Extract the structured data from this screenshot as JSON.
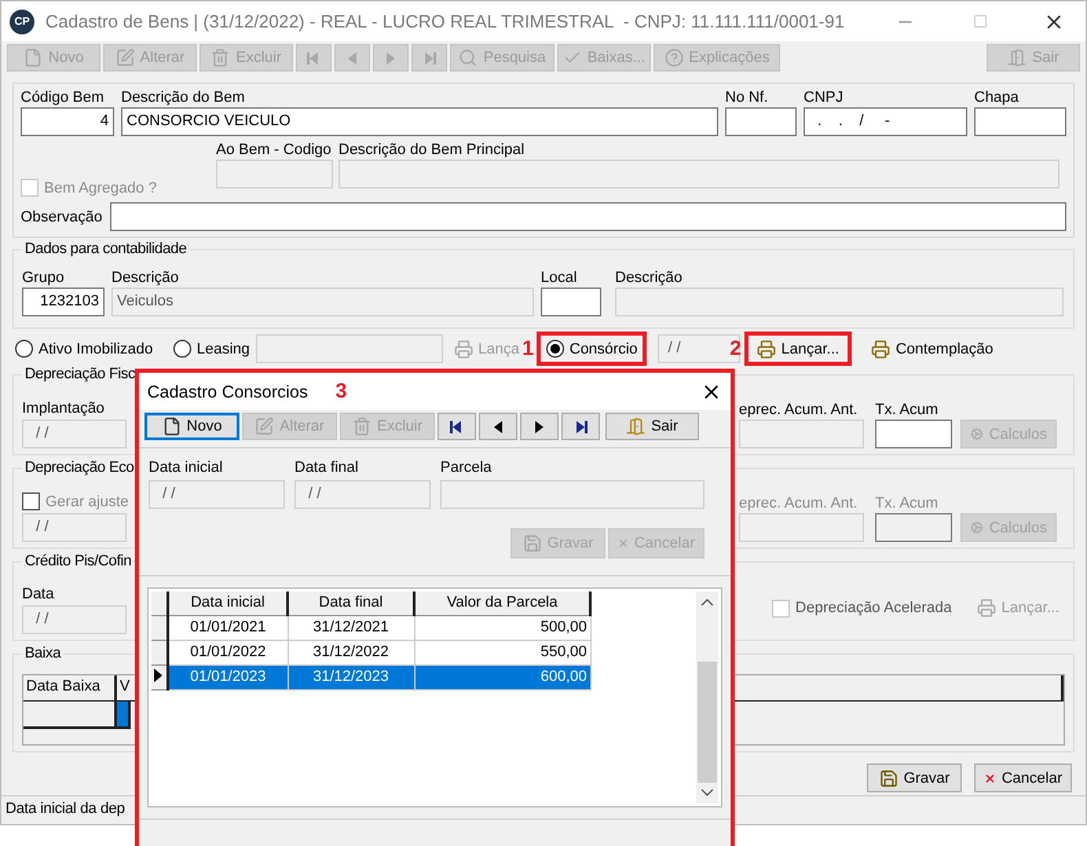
{
  "window": {
    "title": "Cadastro de Bens | (31/12/2022) - REAL - LUCRO REAL TRIMESTRAL  - CNPJ: 11.111.111/0001-91",
    "app_icon": "CP"
  },
  "toolbar": [
    {
      "kind": "new",
      "label": "Novo",
      "disabled": true
    },
    {
      "kind": "edit",
      "label": "Alterar",
      "disabled": true
    },
    {
      "kind": "delete",
      "label": "Excluir",
      "disabled": true
    },
    {
      "kind": "first",
      "disabled": true
    },
    {
      "kind": "prev",
      "disabled": true
    },
    {
      "kind": "next",
      "disabled": true
    },
    {
      "kind": "last",
      "disabled": true
    },
    {
      "kind": "search",
      "label": "Pesquisa",
      "disabled": true
    },
    {
      "kind": "check",
      "label": "Baixas...",
      "disabled": true
    },
    {
      "kind": "help",
      "label": "Explicações",
      "disabled": true
    },
    {
      "kind": "exit",
      "label": "Sair",
      "disabled": true
    }
  ],
  "header_fields": [
    {
      "label": "Código Bem",
      "value": "4"
    },
    {
      "label": "Descrição do Bem",
      "value": "CONSORCIO VEICULO"
    },
    {
      "label": "No Nf."
    },
    {
      "label": "CNPJ",
      "value": "  .    .    /     -"
    },
    {
      "label": "Chapa"
    }
  ],
  "bem_agregado": {
    "label": "Bem Agregado ?",
    "checked": false,
    "disabled": true
  },
  "principal_fields": [
    {
      "label": "Ao Bem - Codigo"
    },
    {
      "label": "Descrição do Bem Principal"
    }
  ],
  "observacao": {
    "label": "Observação"
  },
  "contabilidade": {
    "title": "Dados para contabilidade",
    "fields": [
      {
        "label": "Grupo",
        "value": "1232103",
        "disabled": false
      },
      {
        "label": "Descrição",
        "value": "Veiculos",
        "disabled": true
      },
      {
        "label": "Local",
        "disabled": false
      },
      {
        "label": "Descrição",
        "disabled": true
      }
    ]
  },
  "tipo": {
    "radios": [
      {
        "label": "Ativo Imobilizado",
        "selected": false
      },
      {
        "label": "Leasing",
        "selected": false
      },
      {
        "label": "Consórcio",
        "selected": true
      }
    ],
    "leasing_button": "Lança",
    "consorcio_date": "/ /",
    "lancar_button": "Lançar...",
    "contemplacao_button": "Contemplação"
  },
  "annotations": [
    "1",
    "2",
    "3"
  ],
  "groups": [
    {
      "title": "Depreciação Fisc",
      "left": {
        "kind": "date",
        "label": "Implantação",
        "value": "/ /"
      },
      "right": {
        "kind": "fields",
        "labels": [
          "eprec. Acum. Ant.",
          "Tx. Acum"
        ],
        "button": "Calculos",
        "disabled": false
      }
    },
    {
      "title": "Depreciação Eco",
      "left": {
        "kind": "checkdate",
        "label": "Gerar ajuste",
        "checked": false,
        "value": "/ /"
      },
      "right": {
        "kind": "fields",
        "labels": [
          "eprec. Acum. Ant.",
          "Tx. Acum"
        ],
        "button": "Calculos",
        "disabled": true
      }
    },
    {
      "title": "Crédito Pis/Cofin",
      "left": {
        "kind": "date",
        "label": "Data",
        "value": "/ /"
      },
      "right": {
        "kind": "accel",
        "label": "Depreciação Acelerada",
        "checked": false,
        "button": "Lançar..."
      }
    }
  ],
  "baixa": {
    "title": "Baixa",
    "columns": [
      "Data Baixa",
      "V"
    ],
    "rows": [
      {
        "selected": true
      }
    ]
  },
  "footer_buttons": [
    {
      "kind": "save",
      "label": "Gravar"
    },
    {
      "kind": "cancel",
      "label": "Cancelar"
    }
  ],
  "status_bar": "Data inicial da dep",
  "dialog": {
    "title": "Cadastro Consorcios",
    "toolbar": [
      {
        "kind": "new",
        "label": "Novo",
        "disabled": false,
        "focused": true
      },
      {
        "kind": "edit",
        "label": "Alterar",
        "disabled": true,
        "focused": false
      },
      {
        "kind": "delete",
        "label": "Excluir",
        "disabled": true,
        "focused": false
      },
      {
        "kind": "first",
        "disabled": false,
        "focused": false
      },
      {
        "kind": "prev",
        "disabled": false,
        "focused": false
      },
      {
        "kind": "next",
        "disabled": false,
        "focused": false
      },
      {
        "kind": "last",
        "disabled": false,
        "focused": false
      },
      {
        "kind": "exit",
        "label": "Sair",
        "disabled": false,
        "focused": false
      }
    ],
    "fields": [
      {
        "label": "Data inicial",
        "value": "/ /"
      },
      {
        "label": "Data final",
        "value": "/ /"
      },
      {
        "label": "Parcela"
      }
    ],
    "actions": [
      {
        "kind": "save",
        "label": "Gravar",
        "disabled": true
      },
      {
        "kind": "cancel",
        "label": "Cancelar",
        "disabled": true
      }
    ],
    "grid": {
      "columns": [
        "Data inicial",
        "Data final",
        "Valor da Parcela"
      ],
      "rows": [
        {
          "cells": [
            "01/01/2021",
            "31/12/2021",
            "500,00"
          ],
          "selected": false
        },
        {
          "cells": [
            "01/01/2022",
            "31/12/2022",
            "550,00"
          ],
          "selected": false
        },
        {
          "cells": [
            "01/01/2023",
            "31/12/2023",
            "600,00"
          ],
          "selected": true
        }
      ]
    }
  }
}
